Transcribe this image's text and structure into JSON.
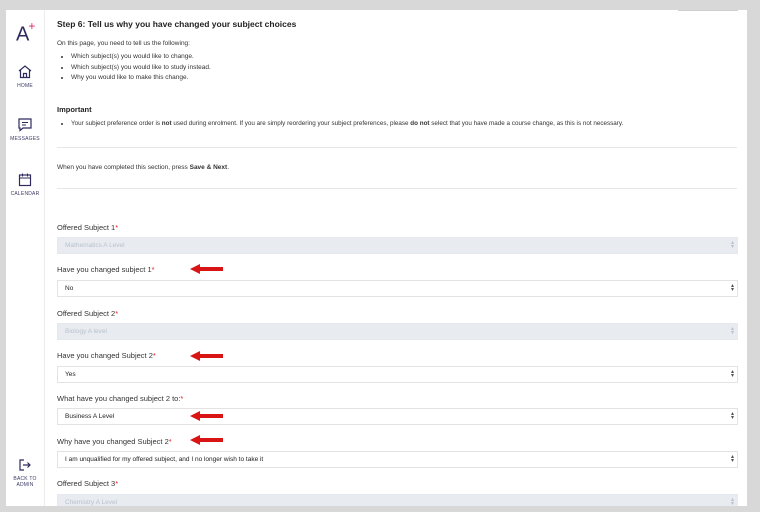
{
  "sidebar": {
    "logo_text": "A",
    "logo_mark": "+",
    "items": [
      {
        "label": "HOME",
        "icon": "home-icon"
      },
      {
        "label": "MESSAGES",
        "icon": "messages-icon"
      },
      {
        "label": "CALENDAR",
        "icon": "calendar-icon"
      }
    ],
    "bottom": {
      "label_line1": "BACK TO",
      "label_line2": "ADMIN",
      "icon": "logout-icon"
    }
  },
  "step": {
    "title": "Step 6: Tell us why you have changed your subject choices",
    "intro": "On this page, you need to tell us the following:",
    "bullets": [
      "Which subject(s) you would like to change.",
      "Which subject(s) you would like to study instead.",
      "Why you would like to make this change."
    ],
    "important_heading": "Important",
    "important": {
      "part1": "Your subject preference order is ",
      "bold1": "not",
      "part2": " used during enrolment. If you are simply reordering your subject preferences, please ",
      "bold2": "do not",
      "part3": " select that you have made a course change, as this is not necessary."
    },
    "complete": {
      "prefix": "When you have completed this section, press ",
      "bold": "Save & Next",
      "suffix": "."
    }
  },
  "form": {
    "required_mark": "*",
    "fields": [
      {
        "label": "Offered Subject 1",
        "value": "Mathematics A Level",
        "disabled": true
      },
      {
        "label": "Have you changed subject 1",
        "value": "No",
        "disabled": false
      },
      {
        "label": "Offered Subject 2",
        "value": "Biology A level",
        "disabled": true
      },
      {
        "label": "Have you changed Subject 2",
        "value": "Yes",
        "disabled": false
      },
      {
        "label": "What have you changed subject 2 to:",
        "value": "Business A Level",
        "disabled": false
      },
      {
        "label": "Why have you changed Subject 2",
        "value": "I am unqualified for my offered subject, and I no longer wish to take it",
        "disabled": false
      },
      {
        "label": "Offered Subject 3",
        "value": "Chemistry A Level",
        "disabled": true
      }
    ]
  },
  "colors": {
    "brand": "#2f2b5e",
    "accent": "#e0245e",
    "required": "#e02020",
    "annotation_arrow": "#d91414",
    "disabled_bg": "#e8ecf1"
  }
}
